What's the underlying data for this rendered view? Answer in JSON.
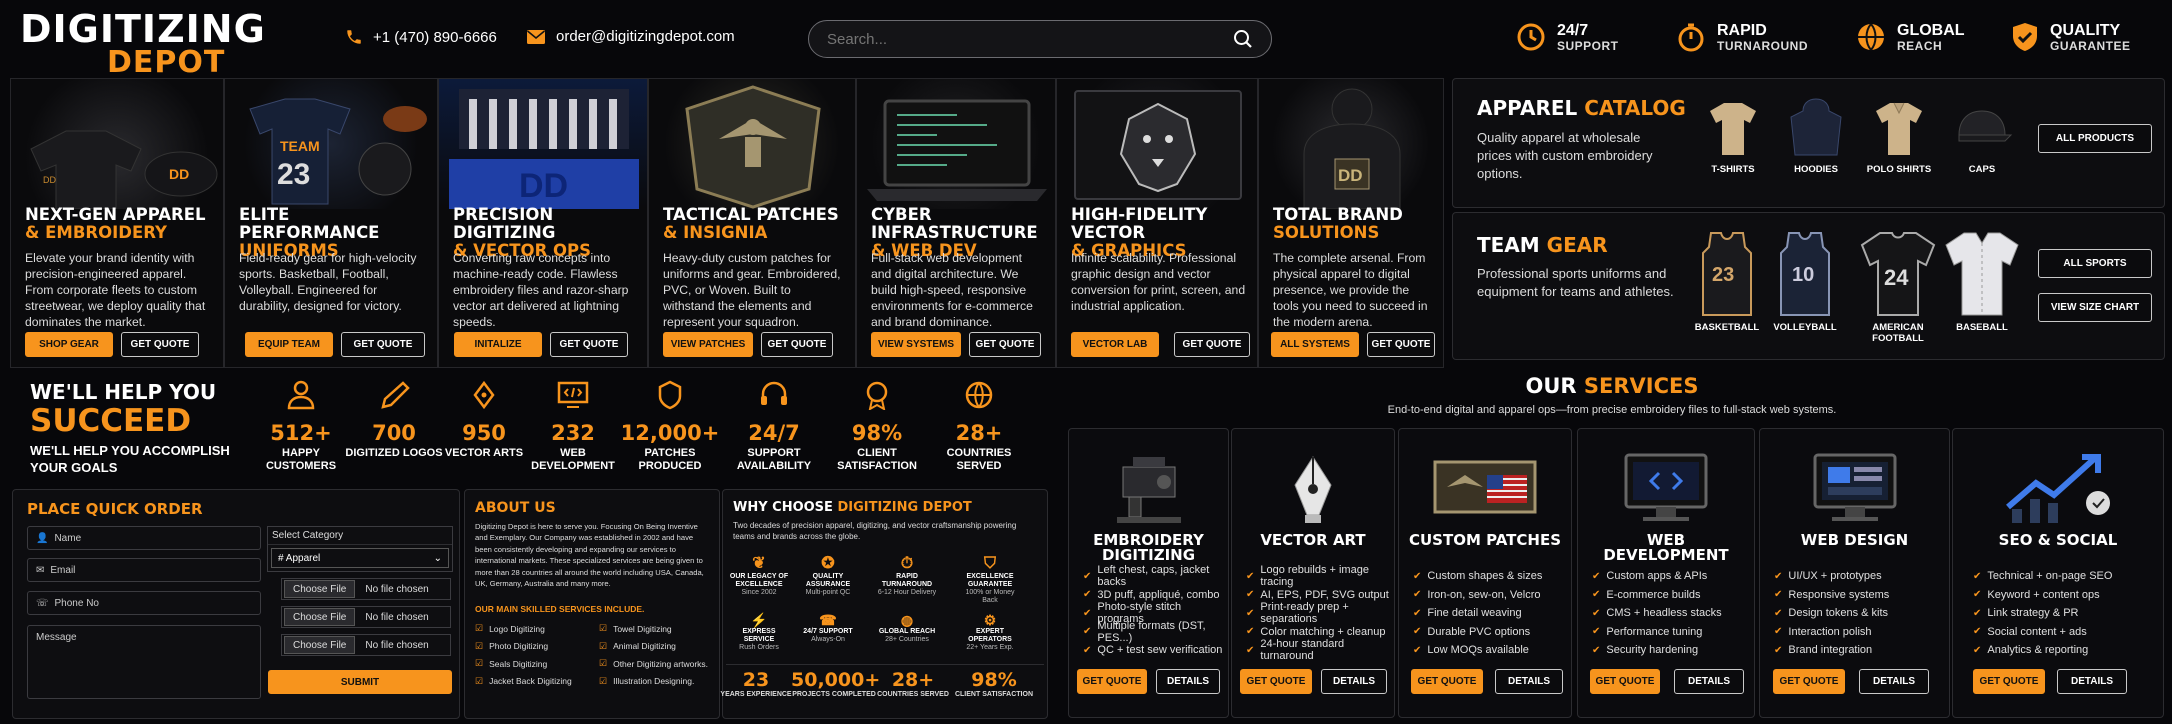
{
  "brand": {
    "line1": "DIGITIZING",
    "line2": "DEPOT"
  },
  "header": {
    "phone": "+1 (470) 890-6666",
    "email": "order@digitizingdepot.com",
    "search_placeholder": "Search...",
    "features": [
      {
        "title": "24/7",
        "sub": "SUPPORT",
        "icon": "clock-phone-icon"
      },
      {
        "title": "RAPID",
        "sub": "TURNAROUND",
        "icon": "stopwatch-icon"
      },
      {
        "title": "GLOBAL",
        "sub": "REACH",
        "icon": "globe-icon"
      },
      {
        "title": "QUALITY",
        "sub": "GUARANTEE",
        "icon": "shield-check-icon"
      }
    ]
  },
  "cards": [
    {
      "title": "NEXT-GEN APPAREL",
      "sub": "& EMBROIDERY",
      "desc": "Elevate your brand identity with precision-engineered apparel. From corporate fleets to custom streetwear, we deploy quality that dominates the market.",
      "btn1": "SHOP GEAR",
      "btn2": "GET QUOTE"
    },
    {
      "title": "ELITE PERFORMANCE",
      "sub": "UNIFORMS",
      "desc": "Field-ready gear for high-velocity sports. Basketball, Football, Volleyball. Engineered for durability, designed for victory.",
      "btn1": "EQUIP TEAM",
      "btn2": "GET QUOTE"
    },
    {
      "title": "PRECISION DIGITIZING",
      "sub": "& VECTOR OPS",
      "desc": "Converting raw concepts into machine-ready code. Flawless embroidery files and razor-sharp vector art delivered at lightning speeds.",
      "btn1": "INITALIZE",
      "btn2": "GET QUOTE"
    },
    {
      "title": "TACTICAL PATCHES",
      "sub": "& INSIGNIA",
      "desc": "Heavy-duty custom patches for uniforms and gear. Embroidered, PVC, or Woven. Built to withstand the elements and represent your squadron.",
      "btn1": "VIEW PATCHES",
      "btn2": "GET QUOTE"
    },
    {
      "title": "CYBER INFRASTRUCTURE",
      "sub": "& WEB DEV",
      "desc": "Full-stack web development and digital architecture. We build high-speed, responsive environments for e-commerce and brand dominance.",
      "btn1": "VIEW SYSTEMS",
      "btn2": "GET QUOTE"
    },
    {
      "title": "HIGH-FIDELITY VECTOR",
      "sub": "& GRAPHICS",
      "desc": "Infinite scalability. Professional graphic design and vector conversion for print, screen, and industrial application.",
      "btn1": "VECTOR LAB",
      "btn2": "GET QUOTE"
    },
    {
      "title": "TOTAL BRAND",
      "sub": "SOLUTIONS",
      "desc": "The complete arsenal. From physical apparel to digital presence, we provide the tools you need to succeed in the modern arena.",
      "btn1": "ALL SYSTEMS",
      "btn2": "GET QUOTE"
    }
  ],
  "catalog": {
    "apparel": {
      "title": "APPAREL",
      "title_accent": "CATALOG",
      "desc": "Quality apparel at wholesale prices with custom embroidery options.",
      "items": [
        "T-SHIRTS",
        "HOODIES",
        "POLO SHIRTS",
        "CAPS"
      ],
      "btn": "ALL PRODUCTS"
    },
    "team": {
      "title": "TEAM",
      "title_accent": "GEAR",
      "desc": "Professional sports uniforms and equipment for teams and athletes.",
      "items": [
        "BASKETBALL",
        "VOLLEYBALL",
        "AMERICAN FOOTBALL",
        "BASEBALL"
      ],
      "jerseys": [
        "23",
        "10",
        "24",
        ""
      ],
      "btn1": "ALL SPORTS",
      "btn2": "VIEW SIZE CHART"
    }
  },
  "help": {
    "line1": "WE'LL HELP YOU",
    "line2": "SUCCEED",
    "line3": "WE'LL HELP YOU ACCOMPLISH YOUR GOALS"
  },
  "stats": [
    {
      "value": "512+",
      "label": "HAPPY CUSTOMERS",
      "icon": "users-icon"
    },
    {
      "value": "700",
      "label": "DIGITIZED LOGOS",
      "icon": "pen-nib-icon"
    },
    {
      "value": "950",
      "label": "VECTOR ARTS",
      "icon": "vector-pen-icon"
    },
    {
      "value": "232",
      "label": "WEB DEVELOPMENT",
      "icon": "code-monitor-icon"
    },
    {
      "value": "12,000+",
      "label": "PATCHES PRODUCED",
      "icon": "badge-icon"
    },
    {
      "value": "24/7",
      "label": "SUPPORT AVAILABILITY",
      "icon": "headset-icon"
    },
    {
      "value": "98%",
      "label": "CLIENT SATISFACTION",
      "icon": "medal-icon"
    },
    {
      "value": "28+",
      "label": "COUNTRIES SERVED",
      "icon": "globe-icon"
    }
  ],
  "order": {
    "title": "PLACE QUICK ORDER",
    "name_ph": "Name",
    "email_ph": "Email",
    "phone_ph": "Phone No",
    "message_ph": "Message",
    "category_label": "Select Category",
    "category_value": "# Apparel",
    "file_btn": "Choose File",
    "file_status": "No file chosen",
    "submit": "SUBMIT"
  },
  "about": {
    "title": "ABOUT US",
    "text": "Digitizing Depot is here to serve you. Focusing On Being Inventive and Exemplary. Our Company was established in 2002 and have been consistently developing and expanding our services to international markets. These specialized services are being given to more than 28 countries all around the world including USA, Canada, UK, Germany, Australia and many more.",
    "skills_title": "OUR MAIN SKILLED SERVICES INCLUDE.",
    "skills": [
      "Logo Digitizing",
      "Towel Digitizing",
      "Photo Digitizing",
      "Animal Digitizing",
      "Seals Digitizing",
      "Other Digitizing artworks.",
      "Jacket Back Digitizing",
      "Illustration Designing."
    ]
  },
  "why": {
    "title": "WHY CHOOSE",
    "title_accent": "DIGITIZING DEPOT",
    "desc": "Two decades of precision apparel, digitizing, and vector craftsmanship powering teams and brands across the globe.",
    "items": [
      {
        "t": "OUR LEGACY OF EXCELLENCE",
        "s": "Since 2002"
      },
      {
        "t": "QUALITY ASSURANCE",
        "s": "Multi-point QC"
      },
      {
        "t": "RAPID TURNAROUND",
        "s": "6-12 Hour Delivery"
      },
      {
        "t": "EXCELLENCE GUARANTEE",
        "s": "100% or Money Back"
      },
      {
        "t": "EXPRESS SERVICE",
        "s": "Rush Orders"
      },
      {
        "t": "24/7 SUPPORT",
        "s": "Always-On"
      },
      {
        "t": "GLOBAL REACH",
        "s": "28+ Countries"
      },
      {
        "t": "EXPERT OPERATORS",
        "s": "22+ Years Exp."
      }
    ],
    "bottom": [
      {
        "v": "23",
        "l": "YEARS EXPERIENCE"
      },
      {
        "v": "50,000+",
        "l": "PROJECTS COMPLETED"
      },
      {
        "v": "28+",
        "l": "COUNTRIES SERVED"
      },
      {
        "v": "98%",
        "l": "CLIENT SATISFACTION"
      }
    ]
  },
  "services": {
    "title": "OUR",
    "title_accent": "SERVICES",
    "subtitle": "End-to-end digital and apparel ops—from precise embroidery files to full-stack web systems.",
    "btn1": "GET QUOTE",
    "btn2": "DETAILS",
    "items": [
      {
        "name": "EMBROIDERY DIGITIZING",
        "points": [
          "Left chest, caps, jacket backs",
          "3D puff, appliqué, combo",
          "Photo-style stitch programs",
          "Multiple formats (DST, PES...)",
          "QC + test sew verification"
        ]
      },
      {
        "name": "VECTOR ART",
        "points": [
          "Logo rebuilds + image tracing",
          "AI, EPS, PDF, SVG output",
          "Print-ready prep + separations",
          "Color matching + cleanup",
          "24-hour standard turnaround"
        ]
      },
      {
        "name": "CUSTOM PATCHES",
        "points": [
          "Custom shapes & sizes",
          "Iron-on, sew-on, Velcro",
          "Fine detail weaving",
          "Durable PVC options",
          "Low MOQs available"
        ]
      },
      {
        "name": "WEB DEVELOPMENT",
        "points": [
          "Custom apps & APIs",
          "E-commerce builds",
          "CMS + headless stacks",
          "Performance tuning",
          "Security hardening"
        ]
      },
      {
        "name": "WEB DESIGN",
        "points": [
          "UI/UX + prototypes",
          "Responsive systems",
          "Design tokens & kits",
          "Interaction polish",
          "Brand integration"
        ]
      },
      {
        "name": "SEO & SOCIAL",
        "points": [
          "Technical + on-page SEO",
          "Keyword + content ops",
          "Link strategy & PR",
          "Social content + ads",
          "Analytics & reporting"
        ]
      }
    ]
  }
}
